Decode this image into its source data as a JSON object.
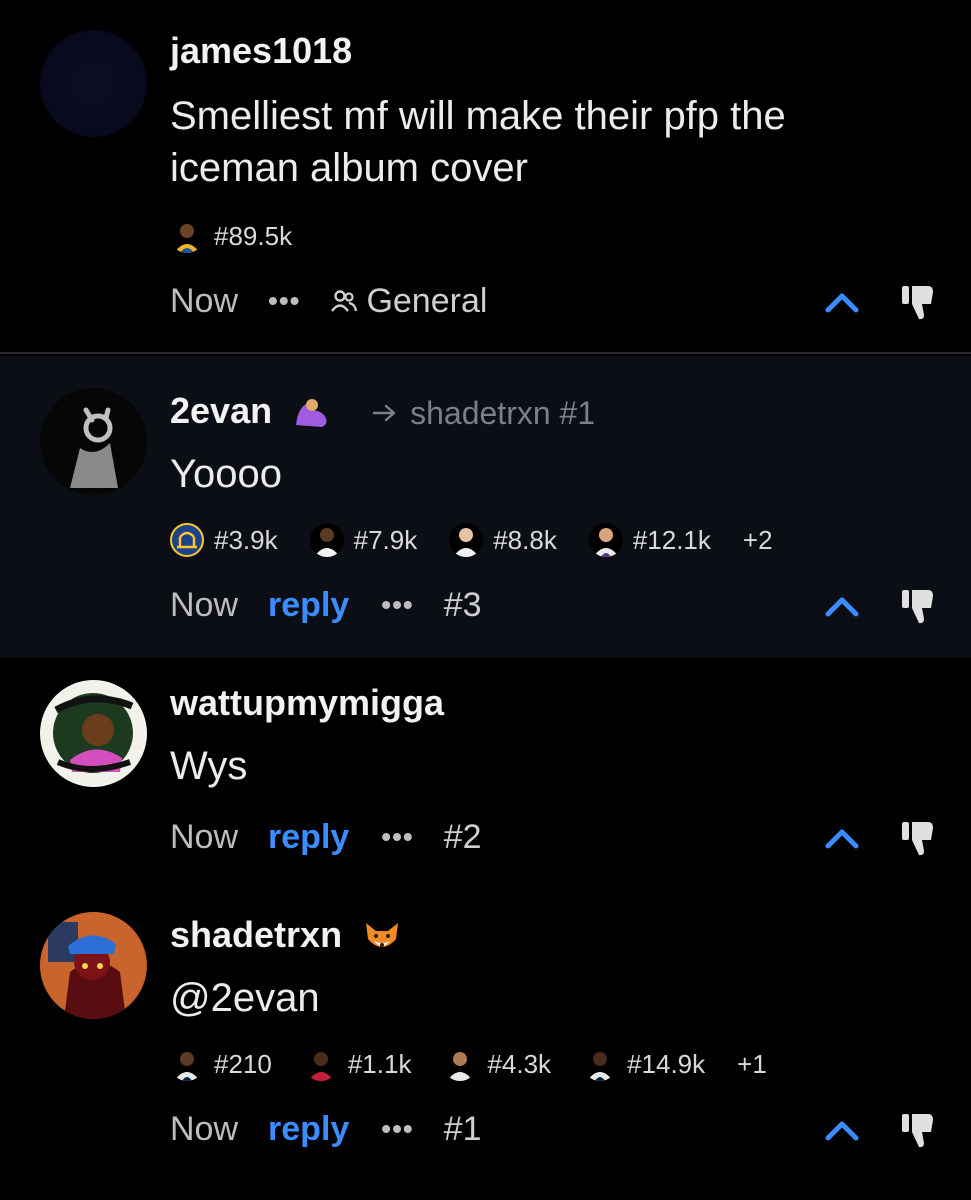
{
  "comments": [
    {
      "username": "james1018",
      "text": "Smelliest mf will make their pfp the iceman album cover",
      "badges": [
        {
          "icon": "player-avatar-icon",
          "label": "#89.5k"
        }
      ],
      "time": "Now",
      "group": "General"
    },
    {
      "username": "2evan",
      "reply_to": "shadetrxn #1",
      "text": "Yoooo",
      "badges": [
        {
          "icon": "warriors-logo-icon",
          "label": "#3.9k"
        },
        {
          "icon": "player-avatar-icon",
          "label": "#7.9k"
        },
        {
          "icon": "player-avatar-icon",
          "label": "#8.8k"
        },
        {
          "icon": "player-avatar-icon",
          "label": "#12.1k"
        }
      ],
      "extra": "+2",
      "time": "Now",
      "reply_label": "reply",
      "number": "#3"
    },
    {
      "username": "wattupmymigga",
      "text": "Wys",
      "time": "Now",
      "reply_label": "reply",
      "number": "#2"
    },
    {
      "username": "shadetrxn",
      "text": "@2evan",
      "badges": [
        {
          "icon": "player-avatar-icon",
          "label": "#210"
        },
        {
          "icon": "player-avatar-icon",
          "label": "#1.1k"
        },
        {
          "icon": "player-avatar-icon",
          "label": "#4.3k"
        },
        {
          "icon": "player-avatar-icon",
          "label": "#14.9k"
        }
      ],
      "extra": "+1",
      "time": "Now",
      "reply_label": "reply",
      "number": "#1"
    }
  ],
  "colors": {
    "background": "#000000",
    "highlight_background": "#0b0e14",
    "accent_blue": "#3b8cff",
    "muted_text": "#bdbdbd"
  }
}
